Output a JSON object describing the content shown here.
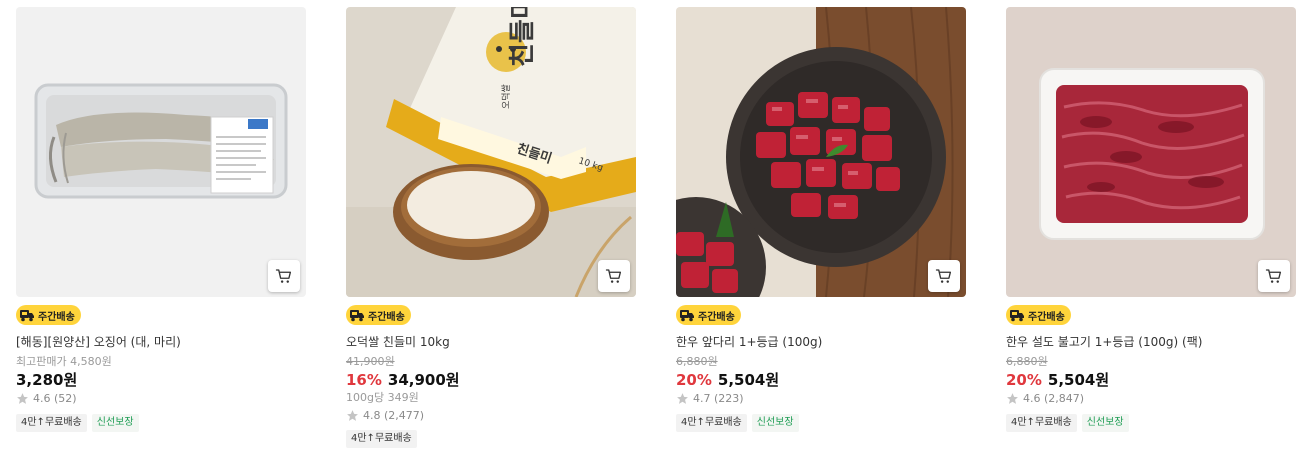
{
  "badge_label": "주간배송",
  "products": [
    {
      "name": "[해동][원양산] 오징어 (대, 마리)",
      "sub_label": "최고판매가 4,580원",
      "discount": "",
      "price": "3,280원",
      "rating": "4.6 (52)",
      "tags": [
        "4만↑무료배송",
        "신선보장"
      ]
    },
    {
      "name": "오덕쌀 친들미 10kg",
      "original_price": "41,900원",
      "discount": "16%",
      "price": "34,900원",
      "unit_price": "100g당 349원",
      "rating": "4.8 (2,477)",
      "tags": [
        "4만↑무료배송"
      ],
      "package_text": "친들미",
      "package_small_text": "오덕쌀",
      "package_weight": "10 kg"
    },
    {
      "name": "한우 앞다리 1+등급 (100g)",
      "original_price": "6,880원",
      "discount": "20%",
      "price": "5,504원",
      "rating": "4.7 (223)",
      "tags": [
        "4만↑무료배송",
        "신선보장"
      ]
    },
    {
      "name": "한우 설도 불고기 1+등급 (100g) (팩)",
      "original_price": "6,880원",
      "discount": "20%",
      "price": "5,504원",
      "rating": "4.6 (2,847)",
      "tags": [
        "4만↑무료배송",
        "신선보장"
      ]
    }
  ],
  "icons": {
    "cart": "cart-icon",
    "star": "star-icon",
    "truck": "delivery-truck-icon"
  },
  "colors": {
    "badge": "#ffd43b",
    "discount": "#e0383e",
    "fresh_tag": "#1f9d55"
  }
}
